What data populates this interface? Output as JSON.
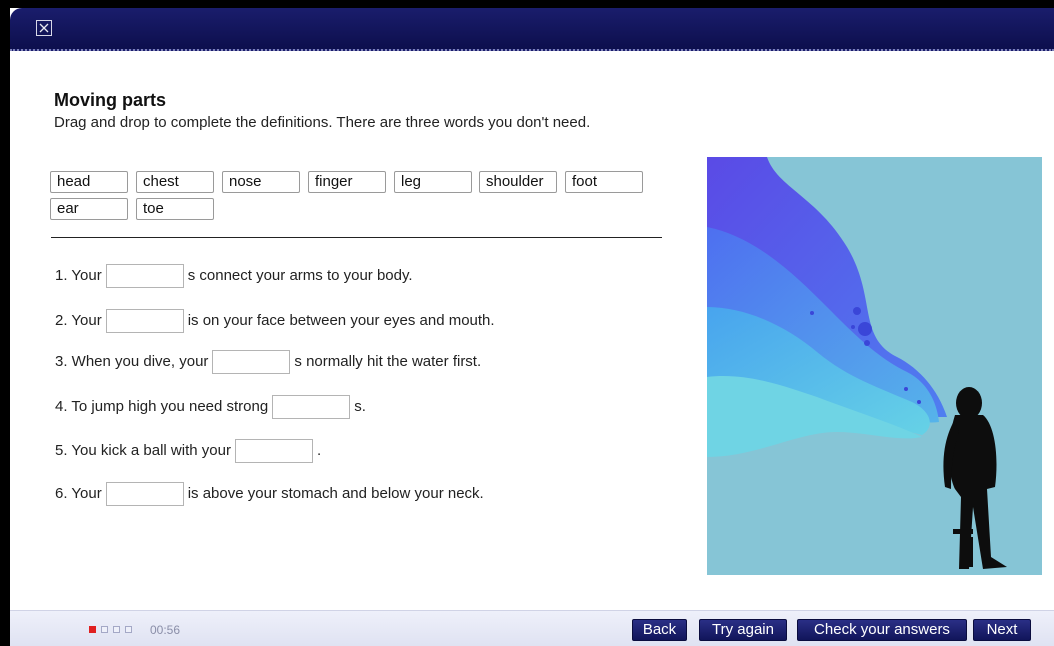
{
  "window": {
    "close_icon": "close-x-icon"
  },
  "exercise": {
    "title": "Moving parts",
    "instructions": "Drag and drop to complete the definitions. There are three words you don't need."
  },
  "word_bank": [
    "head",
    "chest",
    "nose",
    "finger",
    "leg",
    "shoulder",
    "foot",
    "ear",
    "toe"
  ],
  "questions": [
    {
      "before": "1. Your",
      "after": "s connect your arms to your body."
    },
    {
      "before": "2. Your",
      "after": "is on your face between your eyes and mouth."
    },
    {
      "before": "3. When you dive, your",
      "after": "s normally hit the water first."
    },
    {
      "before": "4. To jump high you need strong",
      "after": "s."
    },
    {
      "before": "5. You kick a ball with your",
      "after": "."
    },
    {
      "before": "6. Your",
      "after": "is above your stomach and below your neck."
    }
  ],
  "footer": {
    "progress_total": 4,
    "progress_current": 1,
    "timer": "00:56",
    "buttons": {
      "back": "Back",
      "try_again": "Try again",
      "check": "Check your answers",
      "next": "Next"
    }
  },
  "colors": {
    "titlebar": "#12155c",
    "illustration_bg": "#86c5d6",
    "button_bg": "#1b1f6e",
    "progress_active": "#e02020"
  }
}
